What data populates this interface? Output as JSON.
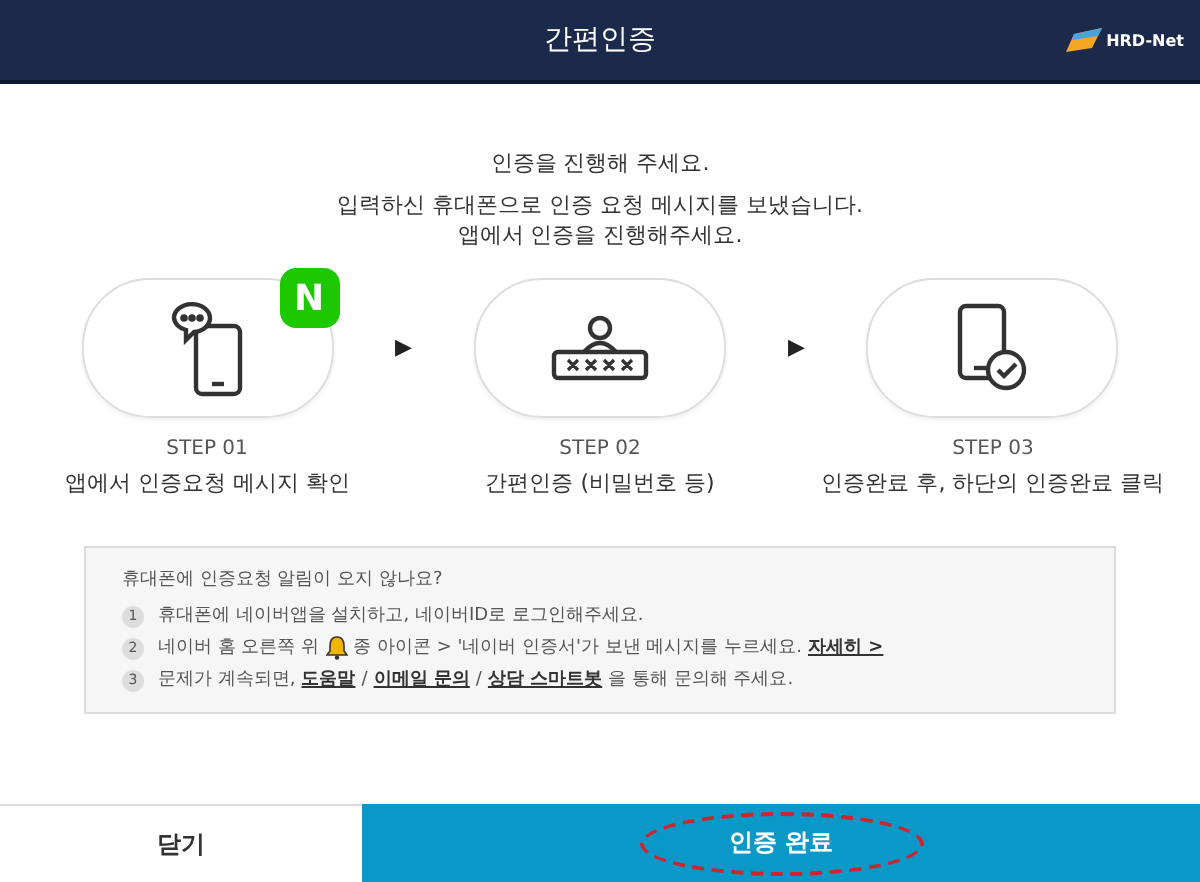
{
  "header": {
    "title": "간편인증",
    "logo": "HRD-Net"
  },
  "intro": {
    "heading": "인증을 진행해 주세요.",
    "lines": [
      "입력하신 휴대폰으로 인증 요청 메시지를 보냈습니다.",
      "앱에서 인증을 진행해주세요."
    ]
  },
  "steps": [
    {
      "kind": "message",
      "step": "STEP 01",
      "label": "앱에서 인증요청 메시지 확인",
      "badge": "N"
    },
    {
      "kind": "password",
      "step": "STEP 02",
      "label": "간편인증 (비밀번호 등)"
    },
    {
      "kind": "check",
      "step": "STEP 03",
      "label": "인증완료 후, 하단의 인증완료 클릭"
    }
  ],
  "arrows": [
    "▶",
    "▶"
  ],
  "notes": {
    "title": "휴대폰에 인증요청 알림이 오지 않나요?",
    "items": [
      {
        "number": "1",
        "parts": [
          {
            "kind": "text",
            "text": "휴대폰에 네이버앱을 설치하고, 네이버ID로 로그인해주세요."
          }
        ]
      },
      {
        "number": "2",
        "parts": [
          {
            "kind": "text",
            "text": "네이버 홈 오른쪽 위"
          },
          {
            "kind": "bell"
          },
          {
            "kind": "text",
            "text": "종 아이콘 > '네이버 인증서'가 보낸 메시지를 누르세요."
          },
          {
            "kind": "link",
            "text": "자세히 >"
          }
        ]
      },
      {
        "number": "3",
        "parts": [
          {
            "kind": "text",
            "text": "문제가 계속되면,"
          },
          {
            "kind": "link",
            "text": "도움말"
          },
          {
            "kind": "text",
            "text": "/"
          },
          {
            "kind": "link",
            "text": "이메일 문의"
          },
          {
            "kind": "text",
            "text": "/"
          },
          {
            "kind": "link",
            "text": "상담 스마트봇"
          },
          {
            "kind": "text",
            "text": "을 통해 문의해 주세요."
          }
        ]
      }
    ]
  },
  "footer": {
    "close": "닫기",
    "confirm": "인증 완료",
    "confirm_highlighted": true
  }
}
